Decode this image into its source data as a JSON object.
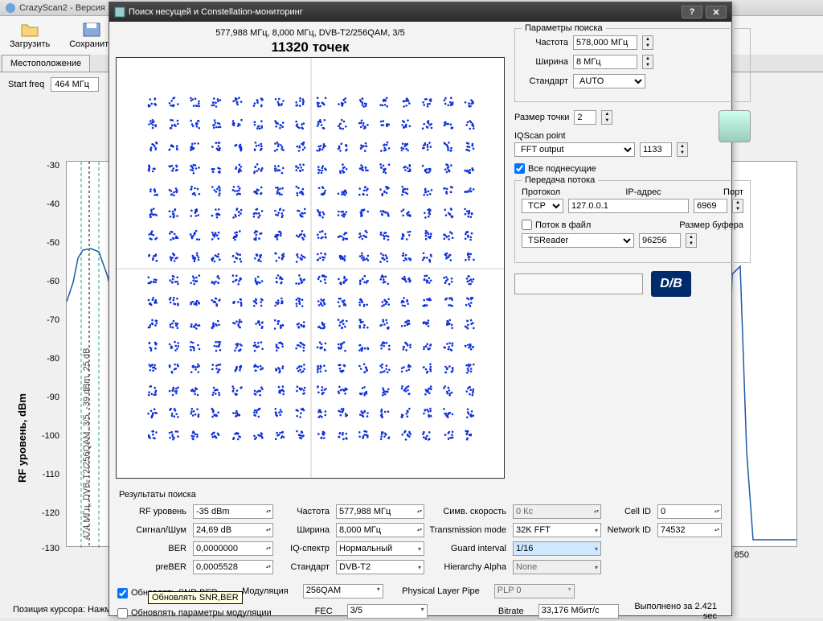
{
  "main": {
    "title": "CrazyScan2 - Версия",
    "toolbar": {
      "load": "Загрузить",
      "save": "Сохранить"
    },
    "tab_location": "Местоположение",
    "start_freq_label": "Start freq",
    "start_freq_value": "464 МГц",
    "y_axis_label": "RF уровень, dBm",
    "y_ticks": [
      "-30",
      "-40",
      "-50",
      "-60",
      "-70",
      "-80",
      "-90",
      "-100",
      "-110",
      "-120",
      "-130"
    ],
    "x_ticks": [
      "850"
    ],
    "cursor_status": "Позиция курсора: Нажми",
    "marker_text": "474 МГц, DVB-T2/256QAM, 3/5, -39 dBm, 25 dB"
  },
  "modal": {
    "title": "Поиск несущей и Constellation-мониторинг",
    "plot_subtitle": "577,988 МГц, 8,000 МГц, DVB-T2/256QAM, 3/5",
    "plot_title": "11320 точек",
    "search_params": {
      "legend": "Параметры поиска",
      "freq_label": "Частота",
      "freq_value": "578,000 МГц",
      "width_label": "Ширина",
      "width_value": "8 МГц",
      "standard_label": "Стандарт",
      "standard_value": "AUTO"
    },
    "point_size_label": "Размер точки",
    "point_size_value": "2",
    "iqscan_label": "IQScan point",
    "iqscan_value": "FFT output",
    "iqscan_num": "1133",
    "all_subcarriers": "Все поднесущие",
    "stream": {
      "legend": "Передача потока",
      "protocol_label": "Протокол",
      "protocol_value": "TCP",
      "ip_label": "IP-адрес",
      "ip_value": "127.0.0.1",
      "port_label": "Порт",
      "port_value": "6969",
      "tofile": "Поток в файл",
      "app_value": "TSReader",
      "bufsize_label": "Размер буфера",
      "bufsize_value": "96256"
    },
    "results_legend": "Результаты поиска",
    "results": {
      "rf_level_l": "RF уровень",
      "rf_level_v": "-35 dBm",
      "snr_l": "Сигнал/Шум",
      "snr_v": "24,69 dB",
      "ber_l": "BER",
      "ber_v": "0,0000000",
      "preber_l": "preBER",
      "preber_v": "0,0005528",
      "freq_l": "Частота",
      "freq_v": "577,988 МГц",
      "width_l": "Ширина",
      "width_v": "8,000 МГц",
      "iq_l": "IQ-спектр",
      "iq_v": "Нормальный",
      "std_l": "Стандарт",
      "std_v": "DVB-T2",
      "mod_l": "Модуляция",
      "mod_v": "256QAM",
      "fec_l": "FEC",
      "fec_v": "3/5",
      "sr_l": "Симв. скорость",
      "sr_v": "0 Кс",
      "tm_l": "Transmission mode",
      "tm_v": "32K FFT",
      "gi_l": "Guard interval",
      "gi_v": "1/16",
      "ha_l": "Hierarchy Alpha",
      "ha_v": "None",
      "plp_l": "Physical Layer Pipe",
      "plp_v": "PLP 0",
      "br_l": "Bitrate",
      "br_v": "33,176 Мбит/с",
      "cell_l": "Cell ID",
      "cell_v": "0",
      "nid_l": "Network ID",
      "nid_v": "74532"
    },
    "chk_snr": "Обновлять SNR,BER",
    "chk_mod": "Обновлять параметры модуляции",
    "tooltip": "Обновлять SNR,BER",
    "elapsed": "Выполнено за 2.421 sec"
  },
  "chart_data": {
    "type": "scatter",
    "title": "11320 точек",
    "subtitle": "577,988 МГц, 8,000 МГц, DVB-T2/256QAM, 3/5",
    "description": "256-QAM IQ constellation diagram, 16×16 grid of clusters",
    "grid": 16,
    "points": 11320,
    "x_range": [
      -1,
      1
    ],
    "y_range": [
      -1,
      1
    ]
  }
}
